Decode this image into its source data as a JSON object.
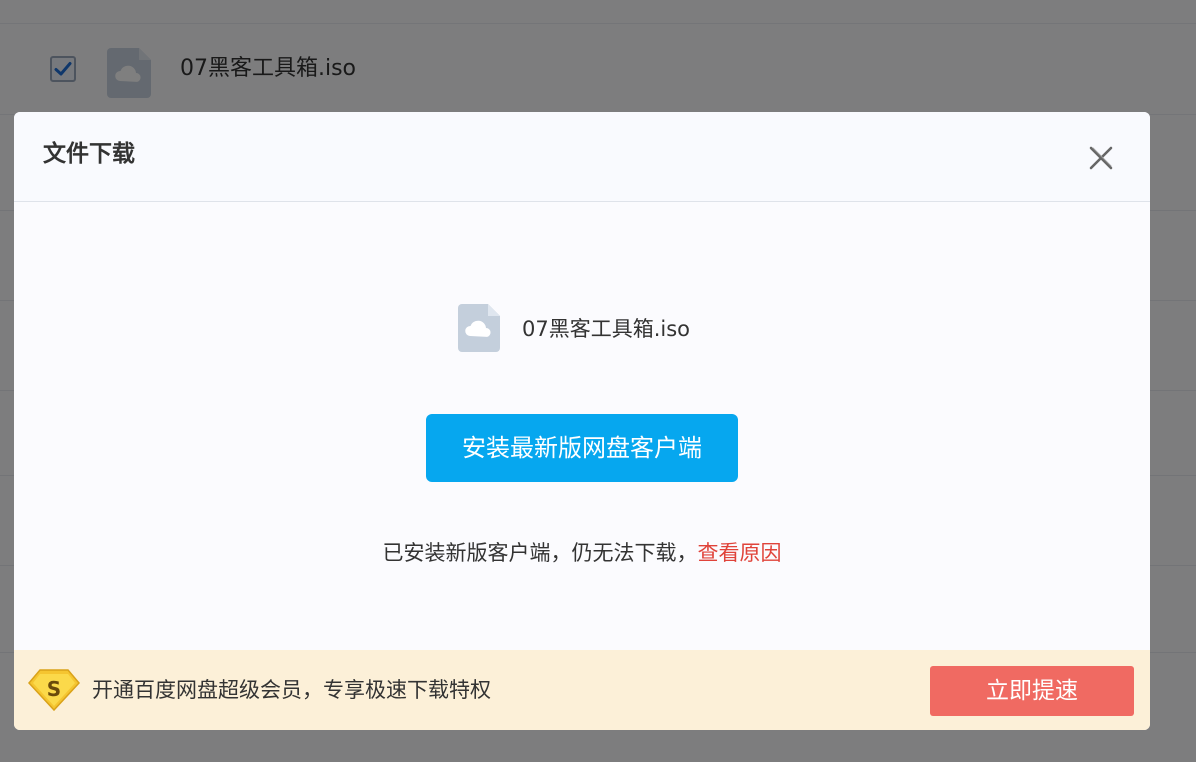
{
  "background_list": {
    "file_name": "07黑客工具箱.iso",
    "checked": true
  },
  "dialog": {
    "title": "文件下载",
    "file_name": "07黑客工具箱.iso",
    "install_button_label": "安装最新版网盘客户端",
    "hint_text": "已安装新版客户端，仍无法下载，",
    "hint_link": "查看原因",
    "footer": {
      "vip_badge_letter": "S",
      "promo_text": "开通百度网盘超级会员，专享极速下载特权",
      "speed_button_label": "立即提速"
    }
  },
  "colors": {
    "primary_button": "#06a7ef",
    "speed_button": "#f06a62",
    "link": "#e0433a",
    "footer_background": "#fcf0d8",
    "vip_badge": "#f5c530"
  },
  "icons": {
    "close": "close-icon",
    "file": "cloud-file-icon",
    "checkbox": "checkmark-icon",
    "vip": "vip-diamond-icon"
  }
}
